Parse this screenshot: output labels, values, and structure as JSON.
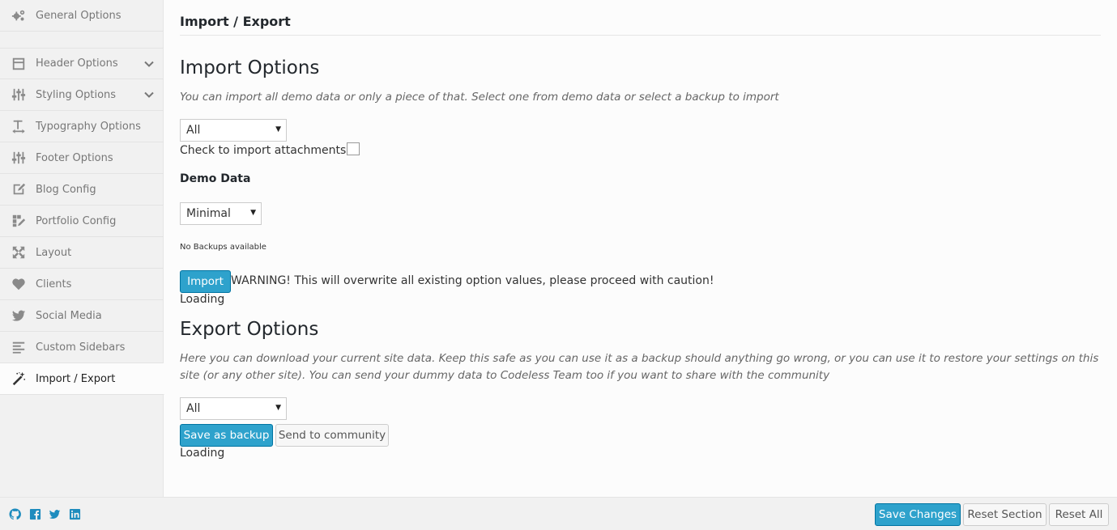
{
  "sidebar": {
    "items": [
      {
        "label": "General Options",
        "icon": "gears-icon",
        "expandable": false
      },
      {
        "label": "Header Options",
        "icon": "header-layout-icon",
        "expandable": true
      },
      {
        "label": "Styling Options",
        "icon": "sliders-icon",
        "expandable": true
      },
      {
        "label": "Typography Options",
        "icon": "text-height-icon",
        "expandable": false
      },
      {
        "label": "Footer Options",
        "icon": "sliders-icon",
        "expandable": false
      },
      {
        "label": "Blog Config",
        "icon": "edit-icon",
        "expandable": false
      },
      {
        "label": "Portfolio Config",
        "icon": "grid-pencil-icon",
        "expandable": false
      },
      {
        "label": "Layout",
        "icon": "arrows-expand-icon",
        "expandable": false
      },
      {
        "label": "Clients",
        "icon": "heart-icon",
        "expandable": false
      },
      {
        "label": "Social Media",
        "icon": "twitter-icon",
        "expandable": false
      },
      {
        "label": "Custom Sidebars",
        "icon": "list-icon",
        "expandable": false
      },
      {
        "label": "Import / Export",
        "icon": "magic-wand-icon",
        "expandable": false,
        "active": true
      }
    ]
  },
  "main": {
    "page_title": "Import / Export",
    "import": {
      "heading": "Import Options",
      "description": "You can import all demo data or only a piece of that. Select one from demo data or select a backup to import",
      "scope_select": "All",
      "attachments_label": "Check to import attachments",
      "demo_label": "Demo Data",
      "demo_select": "Minimal",
      "no_backups": "No Backups available",
      "import_button": "Import",
      "warning": "WARNING! This will overwrite all existing option values, please proceed with caution!",
      "loading": "Loading"
    },
    "export": {
      "heading": "Export Options",
      "description": "Here you can download your current site data. Keep this safe as you can use it as a backup should anything go wrong, or you can use it to restore your settings on this site (or any other site). You can send your dummy data to Codeless Team too if you want to share with the community",
      "scope_select": "All",
      "save_backup_button": "Save as backup",
      "send_community_button": "Send to community",
      "loading": "Loading"
    }
  },
  "footer": {
    "icons": [
      "github-icon",
      "facebook-icon",
      "twitter-icon",
      "linkedin-icon"
    ],
    "save_button": "Save Changes",
    "reset_section_button": "Reset Section",
    "reset_all_button": "Reset All"
  },
  "colors": {
    "accent": "#2ea2cc",
    "sidebar_bg": "#f1f1f1",
    "icon_blue": "#1e8cbe"
  }
}
